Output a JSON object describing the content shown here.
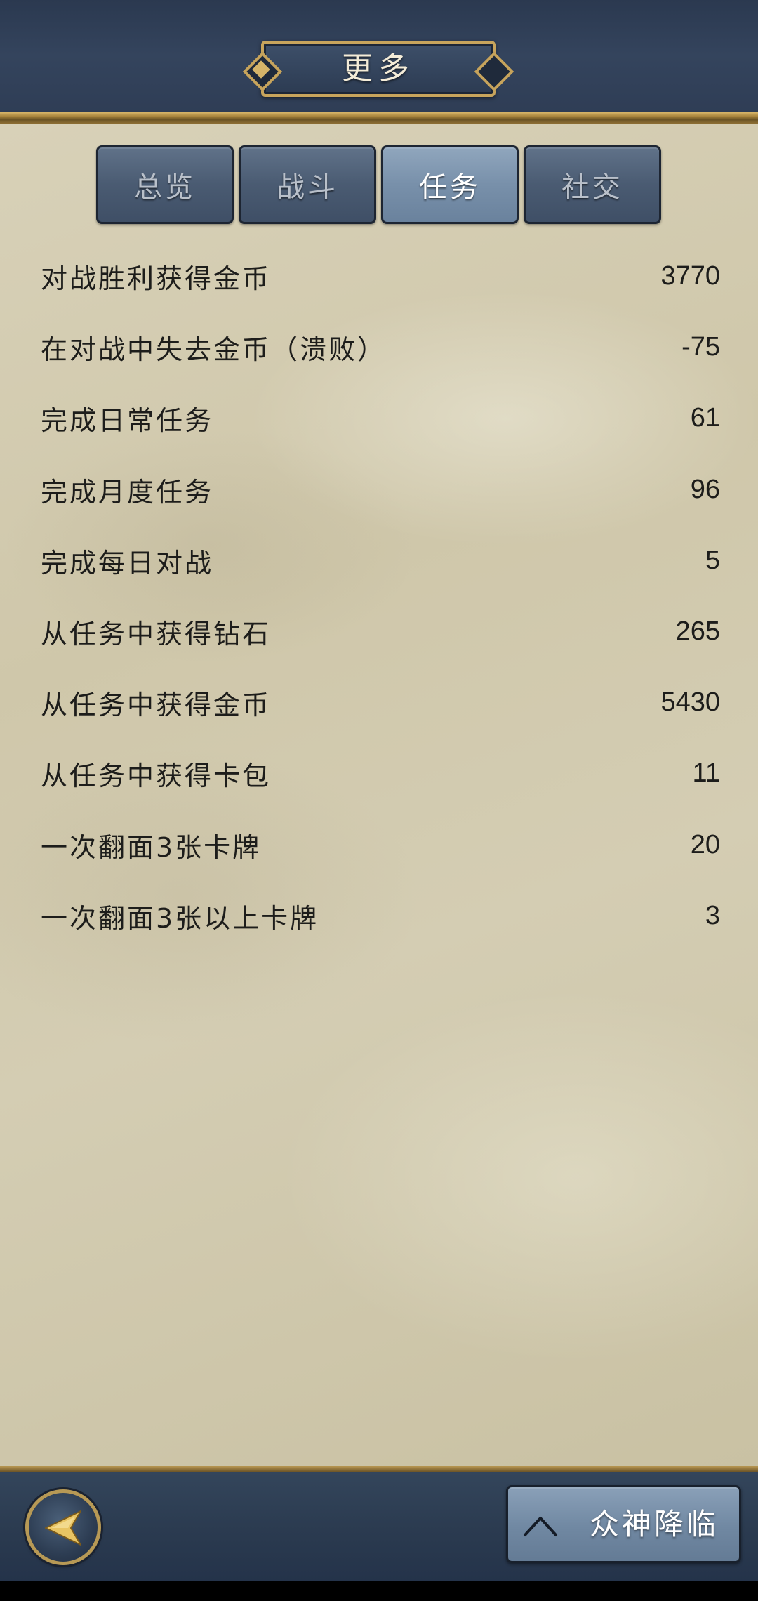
{
  "header": {
    "title": "更多"
  },
  "tabs": [
    {
      "label": "总览",
      "active": false
    },
    {
      "label": "战斗",
      "active": false
    },
    {
      "label": "任务",
      "active": true
    },
    {
      "label": "社交",
      "active": false
    }
  ],
  "stats": [
    {
      "label": "对战胜利获得金币",
      "value": "3770"
    },
    {
      "label": "在对战中失去金币（溃败）",
      "value": "-75"
    },
    {
      "label": "完成日常任务",
      "value": "61"
    },
    {
      "label": "完成月度任务",
      "value": "96"
    },
    {
      "label": "完成每日对战",
      "value": "5"
    },
    {
      "label": "从任务中获得钻石",
      "value": "265"
    },
    {
      "label": "从任务中获得金币",
      "value": "5430"
    },
    {
      "label": "从任务中获得卡包",
      "value": "11"
    },
    {
      "label": "一次翻面3张卡牌",
      "value": "20"
    },
    {
      "label": "一次翻面3张以上卡牌",
      "value": "3"
    }
  ],
  "footer": {
    "back_icon": "back-arrow-icon",
    "expand_icon": "chevron-up-icon",
    "expand_label": "众神降临"
  },
  "colors": {
    "header_bg": "#2e3c54",
    "gold_trim": "#c7a45c",
    "parchment": "#d4cdb3",
    "tab_inactive": "#4a5b72",
    "tab_active": "#7890aa",
    "text_dark": "#1d1d1b"
  }
}
